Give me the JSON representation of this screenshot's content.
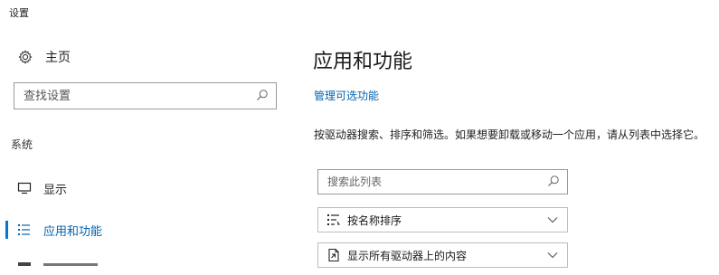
{
  "window": {
    "title": "设置"
  },
  "sidebar": {
    "home_label": "主页",
    "search_placeholder": "查找设置",
    "section": "系统",
    "items": [
      {
        "label": "显示",
        "icon": "monitor-icon",
        "active": false
      },
      {
        "label": "应用和功能",
        "icon": "list-icon",
        "active": true
      }
    ]
  },
  "main": {
    "title": "应用和功能",
    "optional_link": "管理可选功能",
    "description": "按驱动器搜索、排序和筛选。如果想要卸载或移动一个应用，请从列表中选择它。",
    "filter_placeholder": "搜索此列表",
    "sort": {
      "label": "按名称排序",
      "icon": "sort-icon"
    },
    "drive": {
      "label": "显示所有驱动器上的内容",
      "icon": "drive-icon"
    }
  },
  "colors": {
    "accent": "#0078d7",
    "link": "#0063b1"
  }
}
